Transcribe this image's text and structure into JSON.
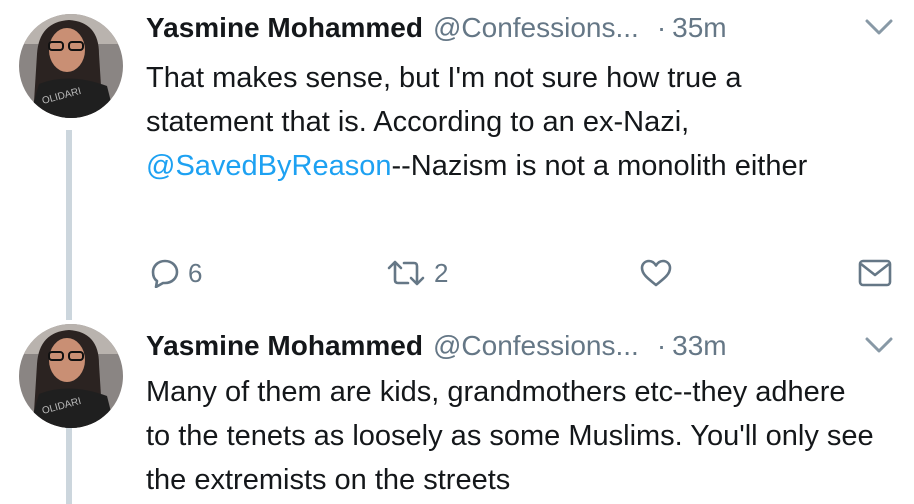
{
  "tweets": [
    {
      "name": "Yasmine Mohammed",
      "handle": "@Confessions...",
      "separator": "·",
      "time": "35m",
      "text_before": "That makes sense, but I'm not sure how true a statement that is. According to an ex-Nazi, ",
      "mention": "@SavedByReason",
      "text_after": "--Nazism is not a monolith either",
      "reply_count": "6",
      "retweet_count": "2",
      "icons": [
        "reply-icon",
        "retweet-icon",
        "like-icon",
        "message-icon",
        "chevron-down-icon"
      ]
    },
    {
      "name": "Yasmine Mohammed",
      "handle": "@Confessions...",
      "separator": "·",
      "time": "33m",
      "text": "Many of them are kids, grandmothers etc--they adhere to the tenets as loosely as some Muslims. You'll only see the extremists on the streets"
    }
  ],
  "colors": {
    "link": "#1da1f2",
    "secondary_text": "#657786",
    "thread_line": "#ccd6dd"
  }
}
